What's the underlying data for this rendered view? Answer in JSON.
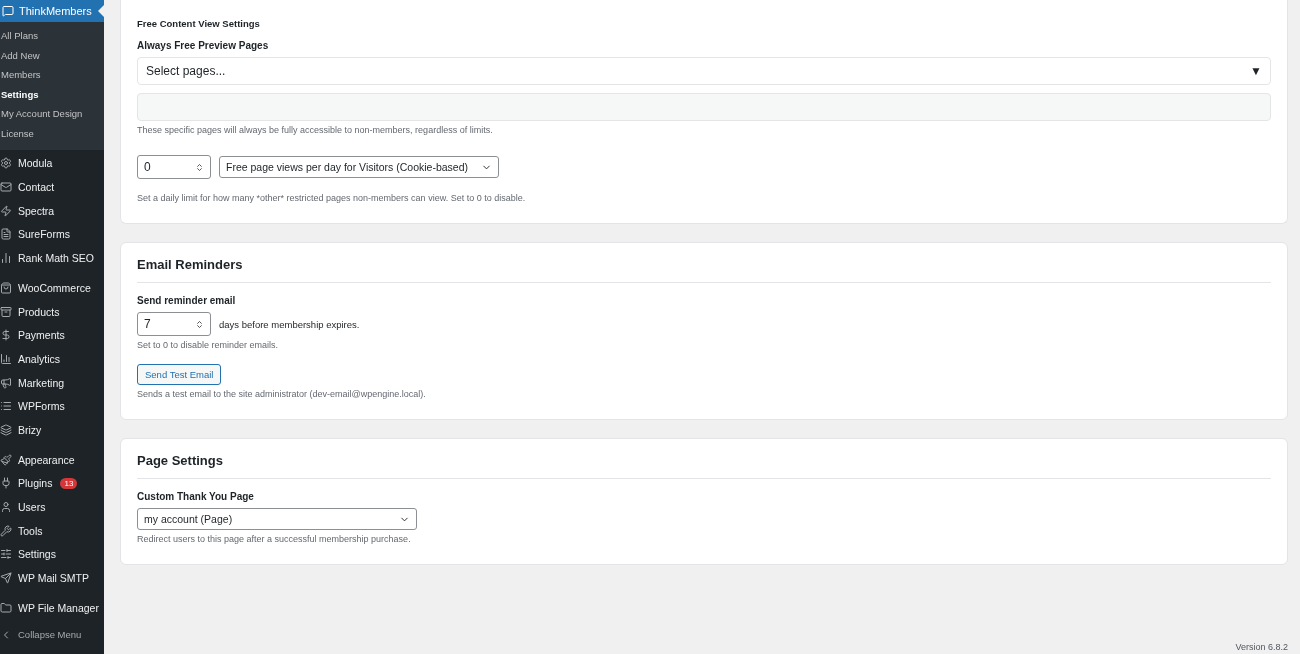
{
  "sidebar": {
    "current": {
      "label": "ThinkMembers",
      "submenu": [
        {
          "label": "All Plans",
          "selected": false
        },
        {
          "label": "Add New",
          "selected": false
        },
        {
          "label": "Members",
          "selected": false
        },
        {
          "label": "Settings",
          "selected": true
        },
        {
          "label": "My Account Design",
          "selected": false
        },
        {
          "label": "License",
          "selected": false
        }
      ]
    },
    "groups": [
      [
        {
          "label": "Modula"
        },
        {
          "label": "Contact"
        },
        {
          "label": "Spectra"
        },
        {
          "label": "SureForms"
        },
        {
          "label": "Rank Math SEO"
        }
      ],
      [
        {
          "label": "WooCommerce"
        },
        {
          "label": "Products"
        },
        {
          "label": "Payments"
        },
        {
          "label": "Analytics"
        },
        {
          "label": "Marketing"
        },
        {
          "label": "WPForms"
        },
        {
          "label": "Brizy"
        }
      ],
      [
        {
          "label": "Appearance"
        },
        {
          "label": "Plugins",
          "badge": "13"
        },
        {
          "label": "Users"
        },
        {
          "label": "Tools"
        },
        {
          "label": "Settings"
        },
        {
          "label": "WP Mail SMTP"
        }
      ],
      [
        {
          "label": "WP File Manager"
        }
      ]
    ],
    "collapse": "Collapse Menu"
  },
  "free_content": {
    "title": "Free Content View Settings",
    "preview_label": "Always Free Preview Pages",
    "select_placeholder": "Select pages...",
    "select_arrow": "▼",
    "preview_help": "These specific pages will always be fully accessible to non-members, regardless of limits.",
    "views_value": "0",
    "views_option": "Free page views per day for Visitors (Cookie-based)",
    "views_help": "Set a daily limit for how many *other* restricted pages non-members can view. Set to 0 to disable."
  },
  "email_reminders": {
    "title": "Email Reminders",
    "label": "Send reminder email",
    "days_value": "7",
    "days_suffix": "days before membership expires.",
    "days_help": "Set to 0 to disable reminder emails.",
    "button": "Send Test Email",
    "button_help": "Sends a test email to the site administrator (dev-email@wpengine.local)."
  },
  "page_settings": {
    "title": "Page Settings",
    "label": "Custom Thank You Page",
    "value": "my account (Page)",
    "help": "Redirect users to this page after a successful membership purchase."
  },
  "footer": {
    "version": "Version 6.8.2"
  }
}
